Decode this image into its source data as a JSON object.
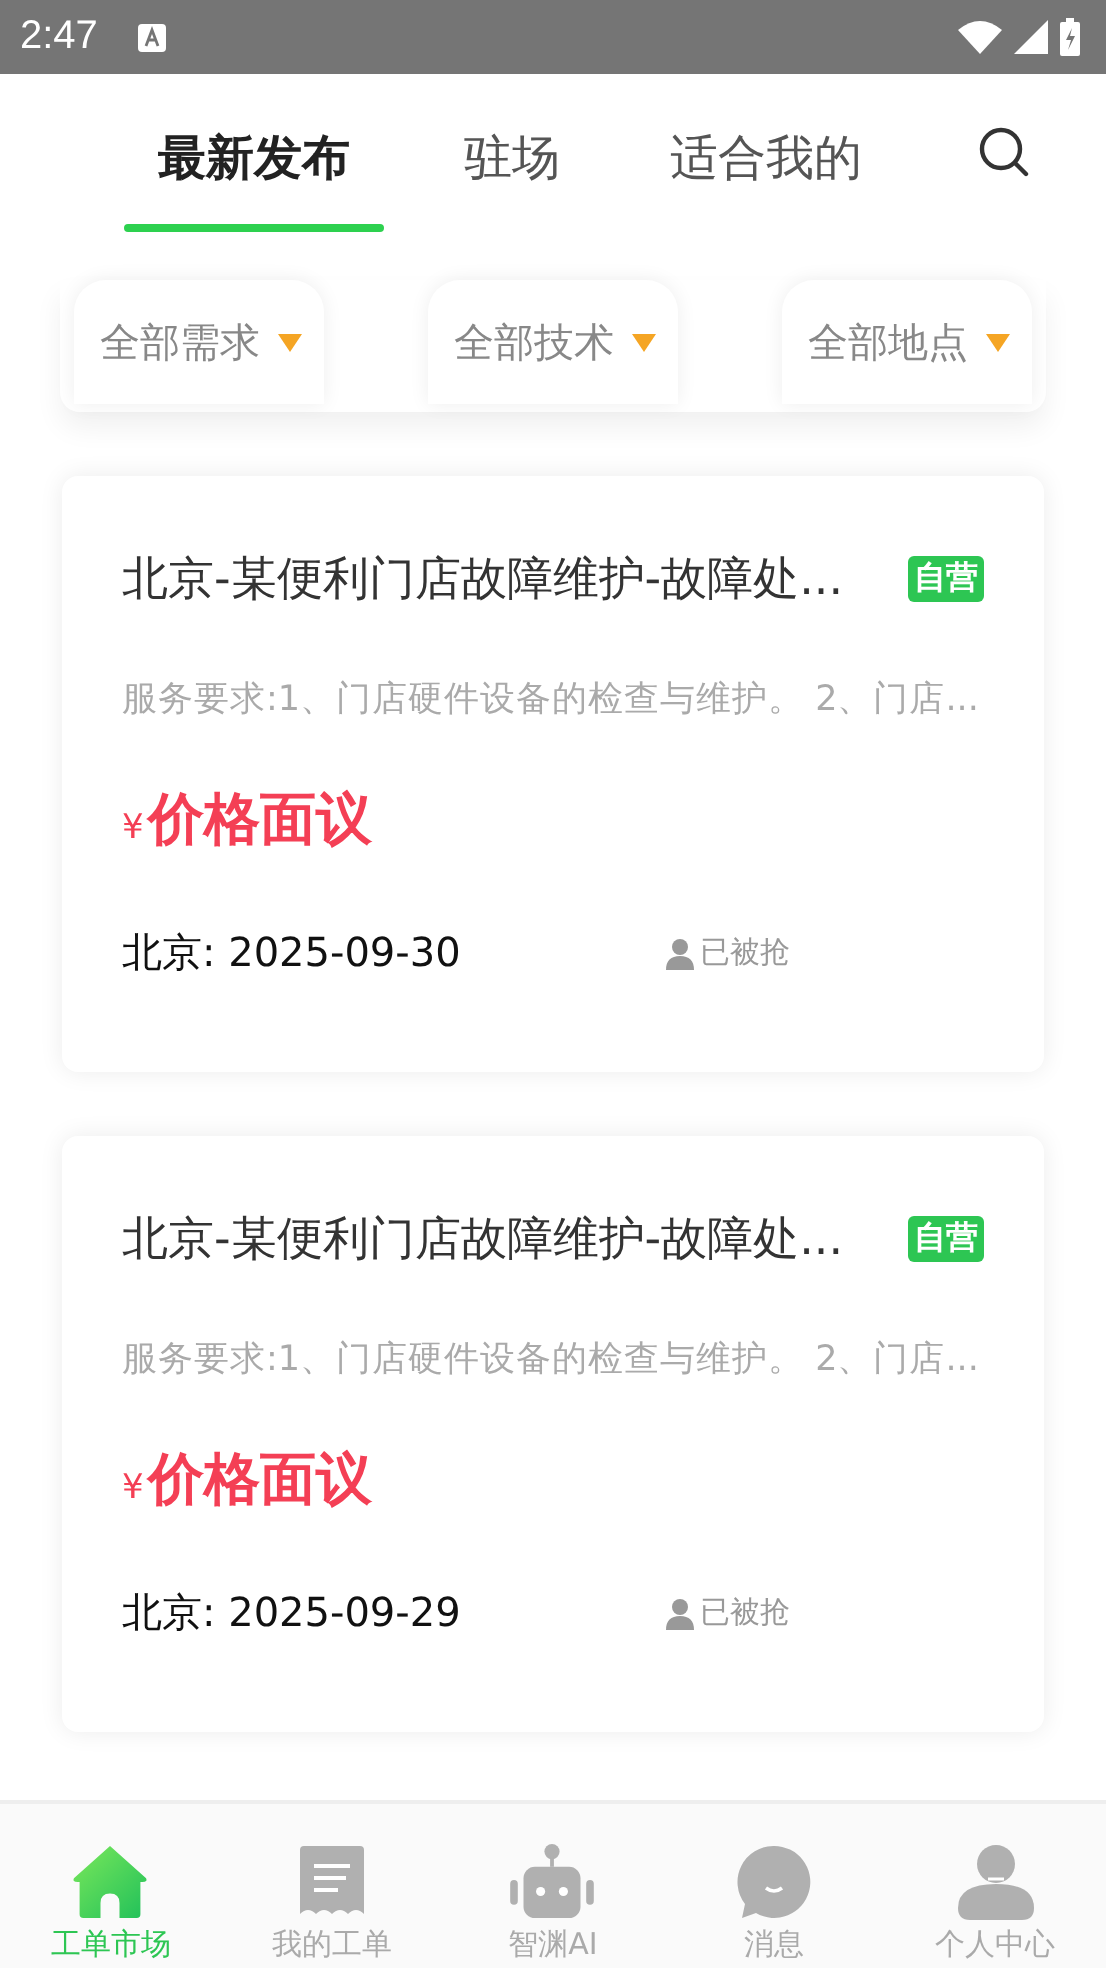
{
  "status_bar": {
    "time": "2:47"
  },
  "tabs": [
    {
      "label": "最新发布",
      "selected": true
    },
    {
      "label": "驻场",
      "selected": false
    },
    {
      "label": "适合我的",
      "selected": false
    }
  ],
  "filters": [
    {
      "label": "全部需求"
    },
    {
      "label": "全部技术"
    },
    {
      "label": "全部地点"
    }
  ],
  "orders": [
    {
      "title": "北京-某便利门店故障维护-故障处...",
      "badge": "自营",
      "description": "服务要求:1、门店硬件设备的检查与维护。 2、门店...",
      "currency": "¥",
      "price": "价格面议",
      "location_date": "北京: 2025-09-30",
      "status": "已被抢"
    },
    {
      "title": "北京-某便利门店故障维护-故障处...",
      "badge": "自营",
      "description": "服务要求:1、门店硬件设备的检查与维护。 2、门店...",
      "currency": "¥",
      "price": "价格面议",
      "location_date": "北京: 2025-09-29",
      "status": "已被抢"
    }
  ],
  "bottom_nav": [
    {
      "kind": "home",
      "label": "工单市场",
      "selected": true
    },
    {
      "kind": "orders",
      "label": "我的工单",
      "selected": false
    },
    {
      "kind": "robot",
      "label": "智渊AI",
      "selected": false
    },
    {
      "kind": "chat",
      "label": "消息",
      "selected": false
    },
    {
      "kind": "person",
      "label": "个人中心",
      "selected": false
    }
  ]
}
